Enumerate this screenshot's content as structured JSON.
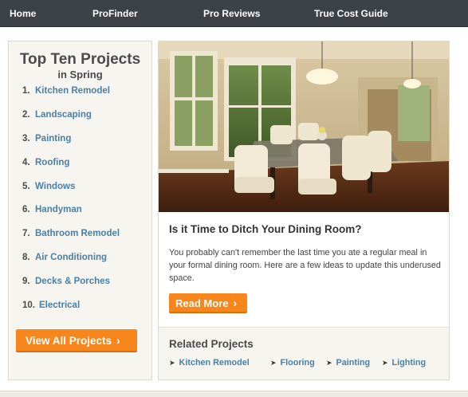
{
  "nav": {
    "items": [
      "Home",
      "ProFinder",
      "Pro Reviews",
      "True Cost Guide"
    ]
  },
  "sidebar": {
    "title": "Top Ten Projects",
    "subtitle": "in Spring",
    "items": [
      {
        "num": "1.",
        "label": "Kitchen Remodel"
      },
      {
        "num": "2.",
        "label": "Landscaping"
      },
      {
        "num": "3.",
        "label": "Painting"
      },
      {
        "num": "4.",
        "label": "Roofing"
      },
      {
        "num": "5.",
        "label": "Windows"
      },
      {
        "num": "6.",
        "label": "Handyman"
      },
      {
        "num": "7.",
        "label": "Bathroom Remodel"
      },
      {
        "num": "8.",
        "label": "Air Conditioning"
      },
      {
        "num": "9.",
        "label": "Decks & Porches"
      },
      {
        "num": "10.",
        "label": "Electrical"
      }
    ],
    "button_label": "View All Projects"
  },
  "article": {
    "title": "Is it Time to Ditch Your Dining Room?",
    "body": "You probably can't remember the last time you ate a regular meal in your formal dining room. Here are a few ideas to update this underused space.",
    "button_label": "Read More"
  },
  "related": {
    "title": "Related Projects",
    "links": [
      "Kitchen Remodel",
      "Flooring",
      "Painting",
      "Lighting"
    ]
  },
  "colors": {
    "nav_bg": "#3d4248",
    "accent_orange": "#f7861c",
    "link_blue": "#4a7fa6",
    "panel_bg": "#f6f5ef"
  }
}
